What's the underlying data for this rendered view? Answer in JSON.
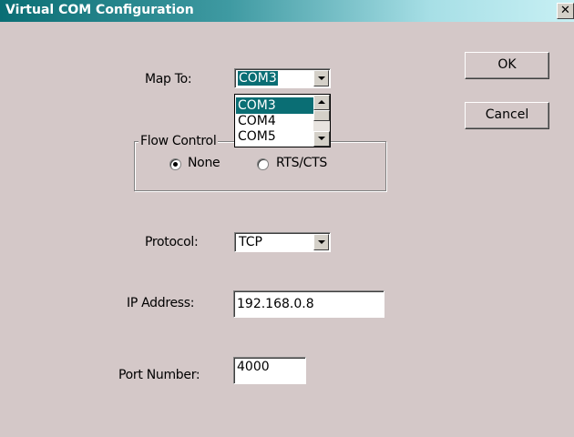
{
  "window": {
    "title": "Virtual COM Configuration",
    "close_glyph": "✕"
  },
  "buttons": {
    "ok_label": "OK",
    "cancel_label": "Cancel"
  },
  "map_to": {
    "label": "Map To:",
    "selected": "COM3",
    "options": [
      "COM3",
      "COM4",
      "COM5"
    ],
    "highlighted_option": "COM3"
  },
  "flow_control": {
    "legend": "Flow Control",
    "options": [
      {
        "label": "None",
        "selected": true
      },
      {
        "label": "RTS/CTS",
        "selected": false
      }
    ]
  },
  "protocol": {
    "label": "Protocol:",
    "selected": "TCP"
  },
  "ip_address": {
    "label": "IP Address:",
    "value": "192.168.0.8"
  },
  "port_number": {
    "label": "Port Number:",
    "value": "4000"
  },
  "colors": {
    "title_gradient_start": "#0a6e74",
    "title_gradient_end": "#c8f0f4",
    "dialog_background": "#d4c8c8",
    "selection_highlight": "#0a6e74"
  },
  "icons": {
    "close": "close-icon",
    "dropdown_arrow": "chevron-down-icon",
    "scroll_up": "chevron-up-icon",
    "scroll_down": "chevron-down-icon"
  }
}
